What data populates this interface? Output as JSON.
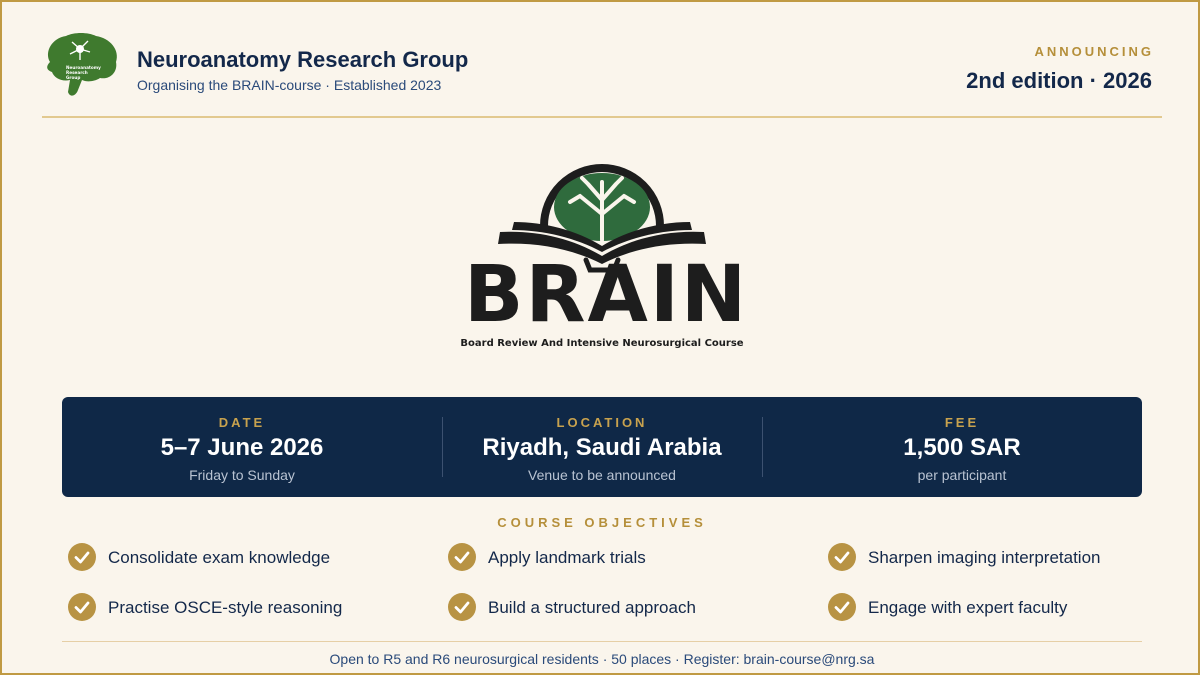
{
  "header": {
    "org_name": "Neuroanatomy Research Group",
    "org_subtitle": "Organising the BRAIN-course · Established 2023",
    "logo_text": "Neuroanatomy Research Group",
    "announce_label": "ANNOUNCING",
    "edition": "2nd edition · 2026"
  },
  "course_logo": {
    "wordmark": "BRAIN",
    "tagline": "Board Review And Intensive Neurosurgical Course"
  },
  "info": [
    {
      "label": "DATE",
      "value": "5–7 June 2026",
      "sub": "Friday to Sunday"
    },
    {
      "label": "LOCATION",
      "value": "Riyadh, Saudi Arabia",
      "sub": "Venue to be announced"
    },
    {
      "label": "FEE",
      "value": "1,500 SAR",
      "sub": "per participant"
    }
  ],
  "objectives": {
    "title": "COURSE OBJECTIVES",
    "items": [
      "Consolidate exam knowledge",
      "Apply landmark trials",
      "Sharpen imaging interpretation",
      "Practise OSCE-style reasoning",
      "Build a structured approach",
      "Engage with expert faculty"
    ]
  },
  "footer": "Open to R5 and R6 neurosurgical residents · 50 places · Register: brain-course@nrg.sa",
  "colors": {
    "navy": "#0f2847",
    "gold": "#c09a43",
    "green": "#3f7a2e",
    "background": "#faf5ec"
  },
  "icons": [
    "brain-logo-icon",
    "book-icon",
    "check-icon"
  ]
}
